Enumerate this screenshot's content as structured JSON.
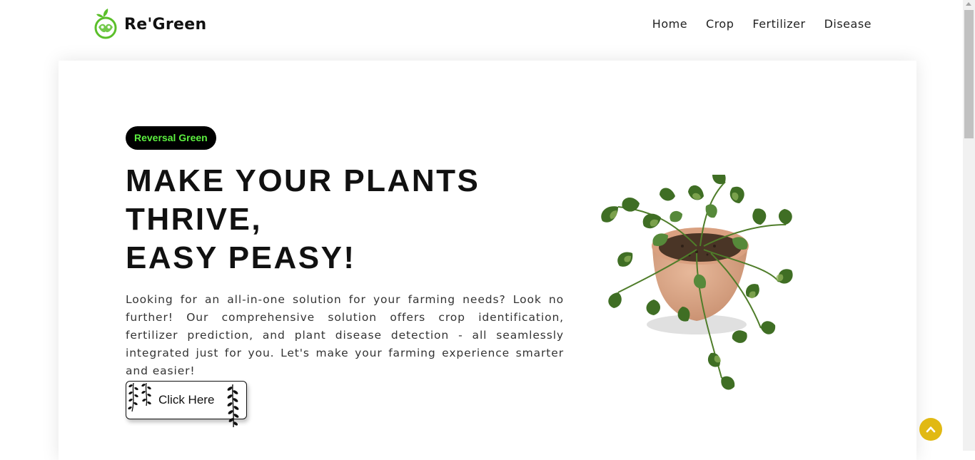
{
  "brand": {
    "name": "Re'Green",
    "logo_icon": "leaf-face-logo"
  },
  "nav": {
    "items": [
      {
        "label": "Home"
      },
      {
        "label": "Crop"
      },
      {
        "label": "Fertilizer"
      },
      {
        "label": "Disease"
      }
    ]
  },
  "hero": {
    "badge": "Reversal Green",
    "title_lines": [
      "MAKE YOUR PLANTS",
      "THRIVE,",
      "EASY PEASY!"
    ],
    "description": "Looking for an all-in-one solution for your farming needs? Look no further! Our comprehensive solution offers crop identification, fertilizer prediction, and plant disease detection - all seamlessly integrated just for you. Let's make your farming experience smarter and easier!",
    "cta_label": "Click Here",
    "image_icon": "potted-pothos-plant"
  },
  "back_to_top_icon": "chevron-up-icon",
  "colors": {
    "badge_bg": "#000000",
    "badge_text": "#5cf040",
    "back_to_top": "#e1b913",
    "logo_green": "#5bbf2a"
  }
}
